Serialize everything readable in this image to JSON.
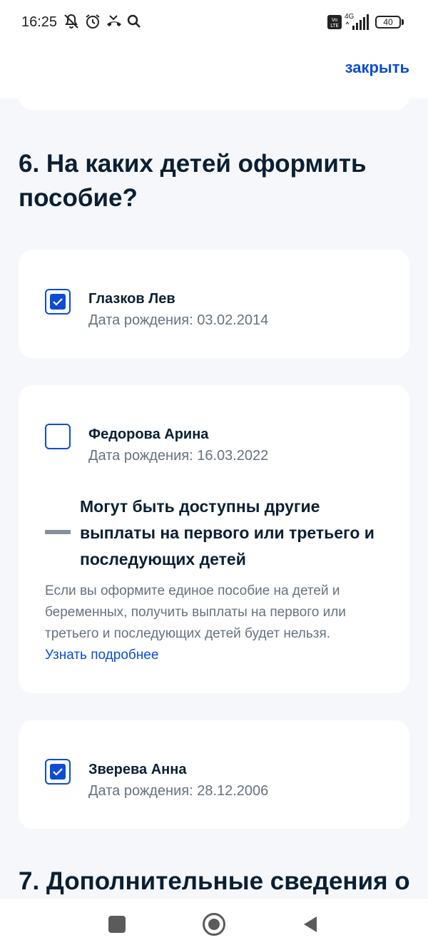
{
  "status_bar": {
    "time": "16:25",
    "battery": "40",
    "network": "4G",
    "volte": "Vo LTE",
    "icons": [
      "bell-off-icon",
      "alarm-icon",
      "missed-call-icon",
      "search-icon",
      "volte-icon",
      "signal-icon",
      "battery-icon"
    ]
  },
  "header": {
    "close_label": "закрыть"
  },
  "section6": {
    "title": "6. На каких детей оформить пособие?"
  },
  "children": [
    {
      "name": "Глазков Лев",
      "dob": "Дата рождения: 03.02.2014",
      "checked": true
    },
    {
      "name": "Федорова Арина",
      "dob": "Дата рождения: 16.03.2022",
      "checked": false
    },
    {
      "name": "Зверева Анна",
      "dob": "Дата рождения: 28.12.2006",
      "checked": true
    }
  ],
  "warning": {
    "title": "Могут быть доступны другие выплаты на первого или третьего и последующих детей",
    "text": "Если вы оформите единое пособие на детей и беременных, получить выплаты на первого или третьего и последующих детей будет нельзя.",
    "link": "Узнать подробнее"
  },
  "section7": {
    "title": "7. Дополнительные сведения о"
  },
  "colors": {
    "accent": "#0d4cd3",
    "background": "#f5f7fa",
    "text": "#0b1f33",
    "secondary_text": "#66727f"
  },
  "nav": {
    "icons": [
      "recents-square-icon",
      "home-circle-icon",
      "back-triangle-icon"
    ]
  }
}
